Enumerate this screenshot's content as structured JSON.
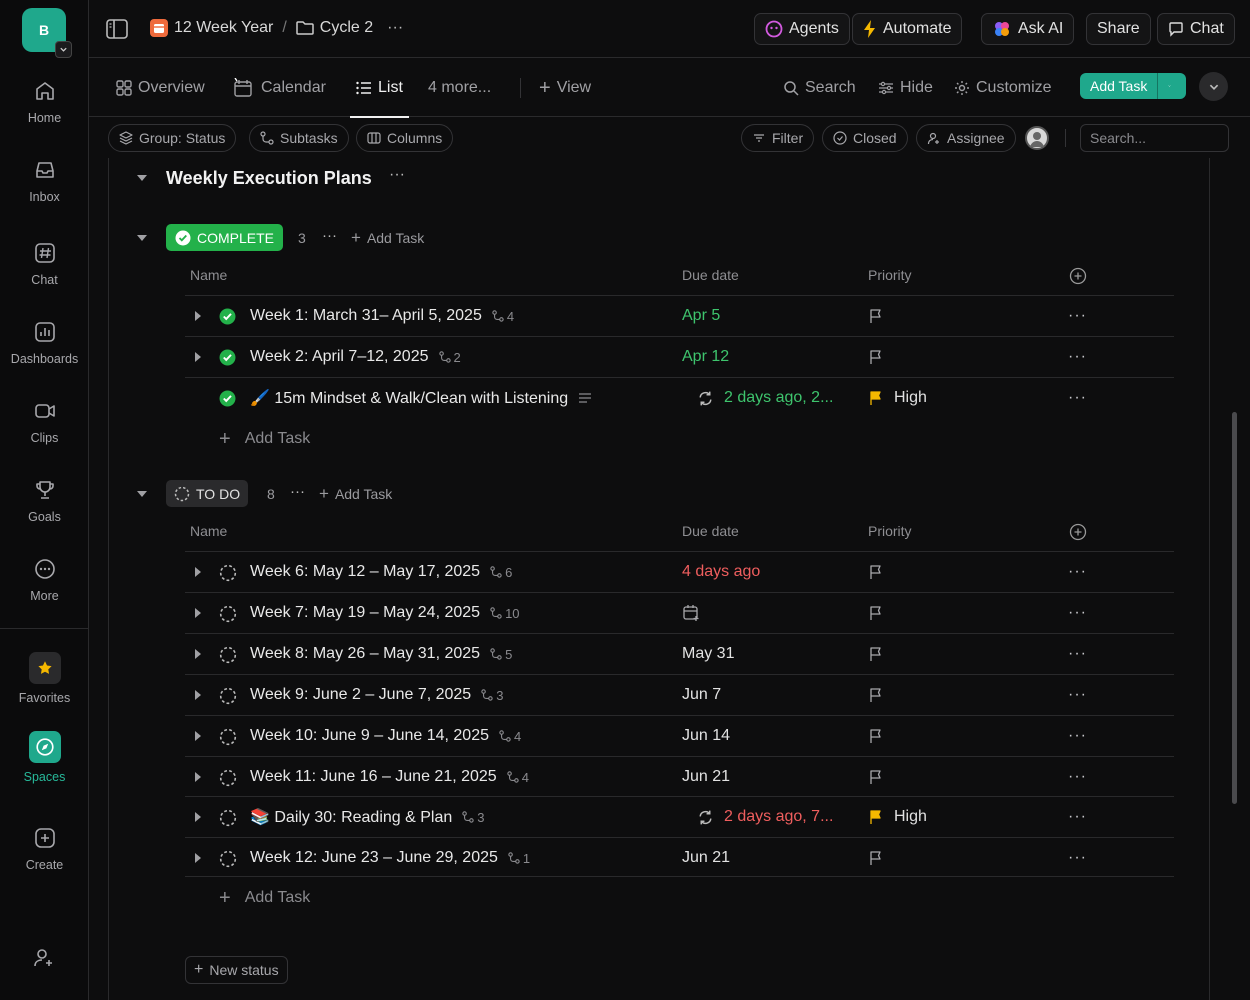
{
  "workspace": {
    "initial": "B"
  },
  "rail": {
    "items": [
      {
        "label": "Home"
      },
      {
        "label": "Inbox"
      },
      {
        "label": "Chat"
      },
      {
        "label": "Dashboards"
      },
      {
        "label": "Clips"
      },
      {
        "label": "Goals"
      },
      {
        "label": "More"
      }
    ],
    "favorites": "Favorites",
    "spaces": "Spaces",
    "create": "Create"
  },
  "breadcrumb": {
    "list": "12 Week Year",
    "sep": "/",
    "folder": "Cycle 2",
    "more": "···"
  },
  "topbar": {
    "agents": "Agents",
    "automate": "Automate",
    "ask_ai": "Ask AI",
    "share": "Share",
    "chat": "Chat"
  },
  "views": {
    "overview": "Overview",
    "calendar": "Calendar",
    "list": "List",
    "more": "4 more...",
    "add_view": "View"
  },
  "view_actions": {
    "search": "Search",
    "hide": "Hide",
    "customize": "Customize",
    "add_task": "Add Task"
  },
  "filters": {
    "group": "Group: Status",
    "subtasks": "Subtasks",
    "columns": "Columns",
    "filter": "Filter",
    "closed": "Closed",
    "assignee": "Assignee",
    "search_placeholder": "Search..."
  },
  "list_title": "Weekly Execution Plans",
  "columns": {
    "name": "Name",
    "due": "Due date",
    "priority": "Priority"
  },
  "groups": [
    {
      "status": "COMPLETE",
      "count": "3",
      "add_task": "Add Task",
      "rows": [
        {
          "name": "Week 1: March 31– April 5, 2025",
          "subtasks": "4",
          "due": "Apr 5",
          "due_color": "green",
          "priority": ""
        },
        {
          "name": "Week 2: April 7–12, 2025",
          "subtasks": "2",
          "due": "Apr 12",
          "due_color": "green",
          "priority": ""
        },
        {
          "name": "🖌️ 15m Mindset & Walk/Clean with Listening",
          "subtasks": "",
          "due": "2 days ago, 2...",
          "due_color": "green",
          "priority": "High"
        }
      ]
    },
    {
      "status": "TO DO",
      "count": "8",
      "add_task": "Add Task",
      "rows": [
        {
          "name": "Week 6: May 12 – May 17, 2025",
          "subtasks": "6",
          "due": "4 days ago",
          "due_color": "red",
          "priority": ""
        },
        {
          "name": "Week 7: May 19 – May 24, 2025",
          "subtasks": "10",
          "due": "",
          "due_color": "white",
          "priority": ""
        },
        {
          "name": "Week 8: May 26 – May 31, 2025",
          "subtasks": "5",
          "due": "May 31",
          "due_color": "white",
          "priority": ""
        },
        {
          "name": "Week 9: June 2 – June 7, 2025",
          "subtasks": "3",
          "due": "Jun 7",
          "due_color": "white",
          "priority": ""
        },
        {
          "name": "Week 10: June 9 – June 14, 2025",
          "subtasks": "4",
          "due": "Jun 14",
          "due_color": "white",
          "priority": ""
        },
        {
          "name": "Week 11: June 16 – June 21, 2025",
          "subtasks": "4",
          "due": "Jun 21",
          "due_color": "white",
          "priority": ""
        },
        {
          "name": "📚 Daily 30: Reading & Plan",
          "subtasks": "3",
          "due": "2 days ago, 7...",
          "due_color": "red",
          "priority": "High"
        },
        {
          "name": "Week 12: June 23 – June 29, 2025",
          "subtasks": "1",
          "due": "Jun 21",
          "due_color": "white",
          "priority": ""
        }
      ]
    }
  ],
  "add_task_row": "Add Task",
  "new_status": "New status",
  "colors": {
    "accent": "#1fa88c",
    "complete": "#23b14a",
    "due_green": "#3ec46d",
    "due_red": "#ef5e5e",
    "flag_high": "#f5b800"
  }
}
